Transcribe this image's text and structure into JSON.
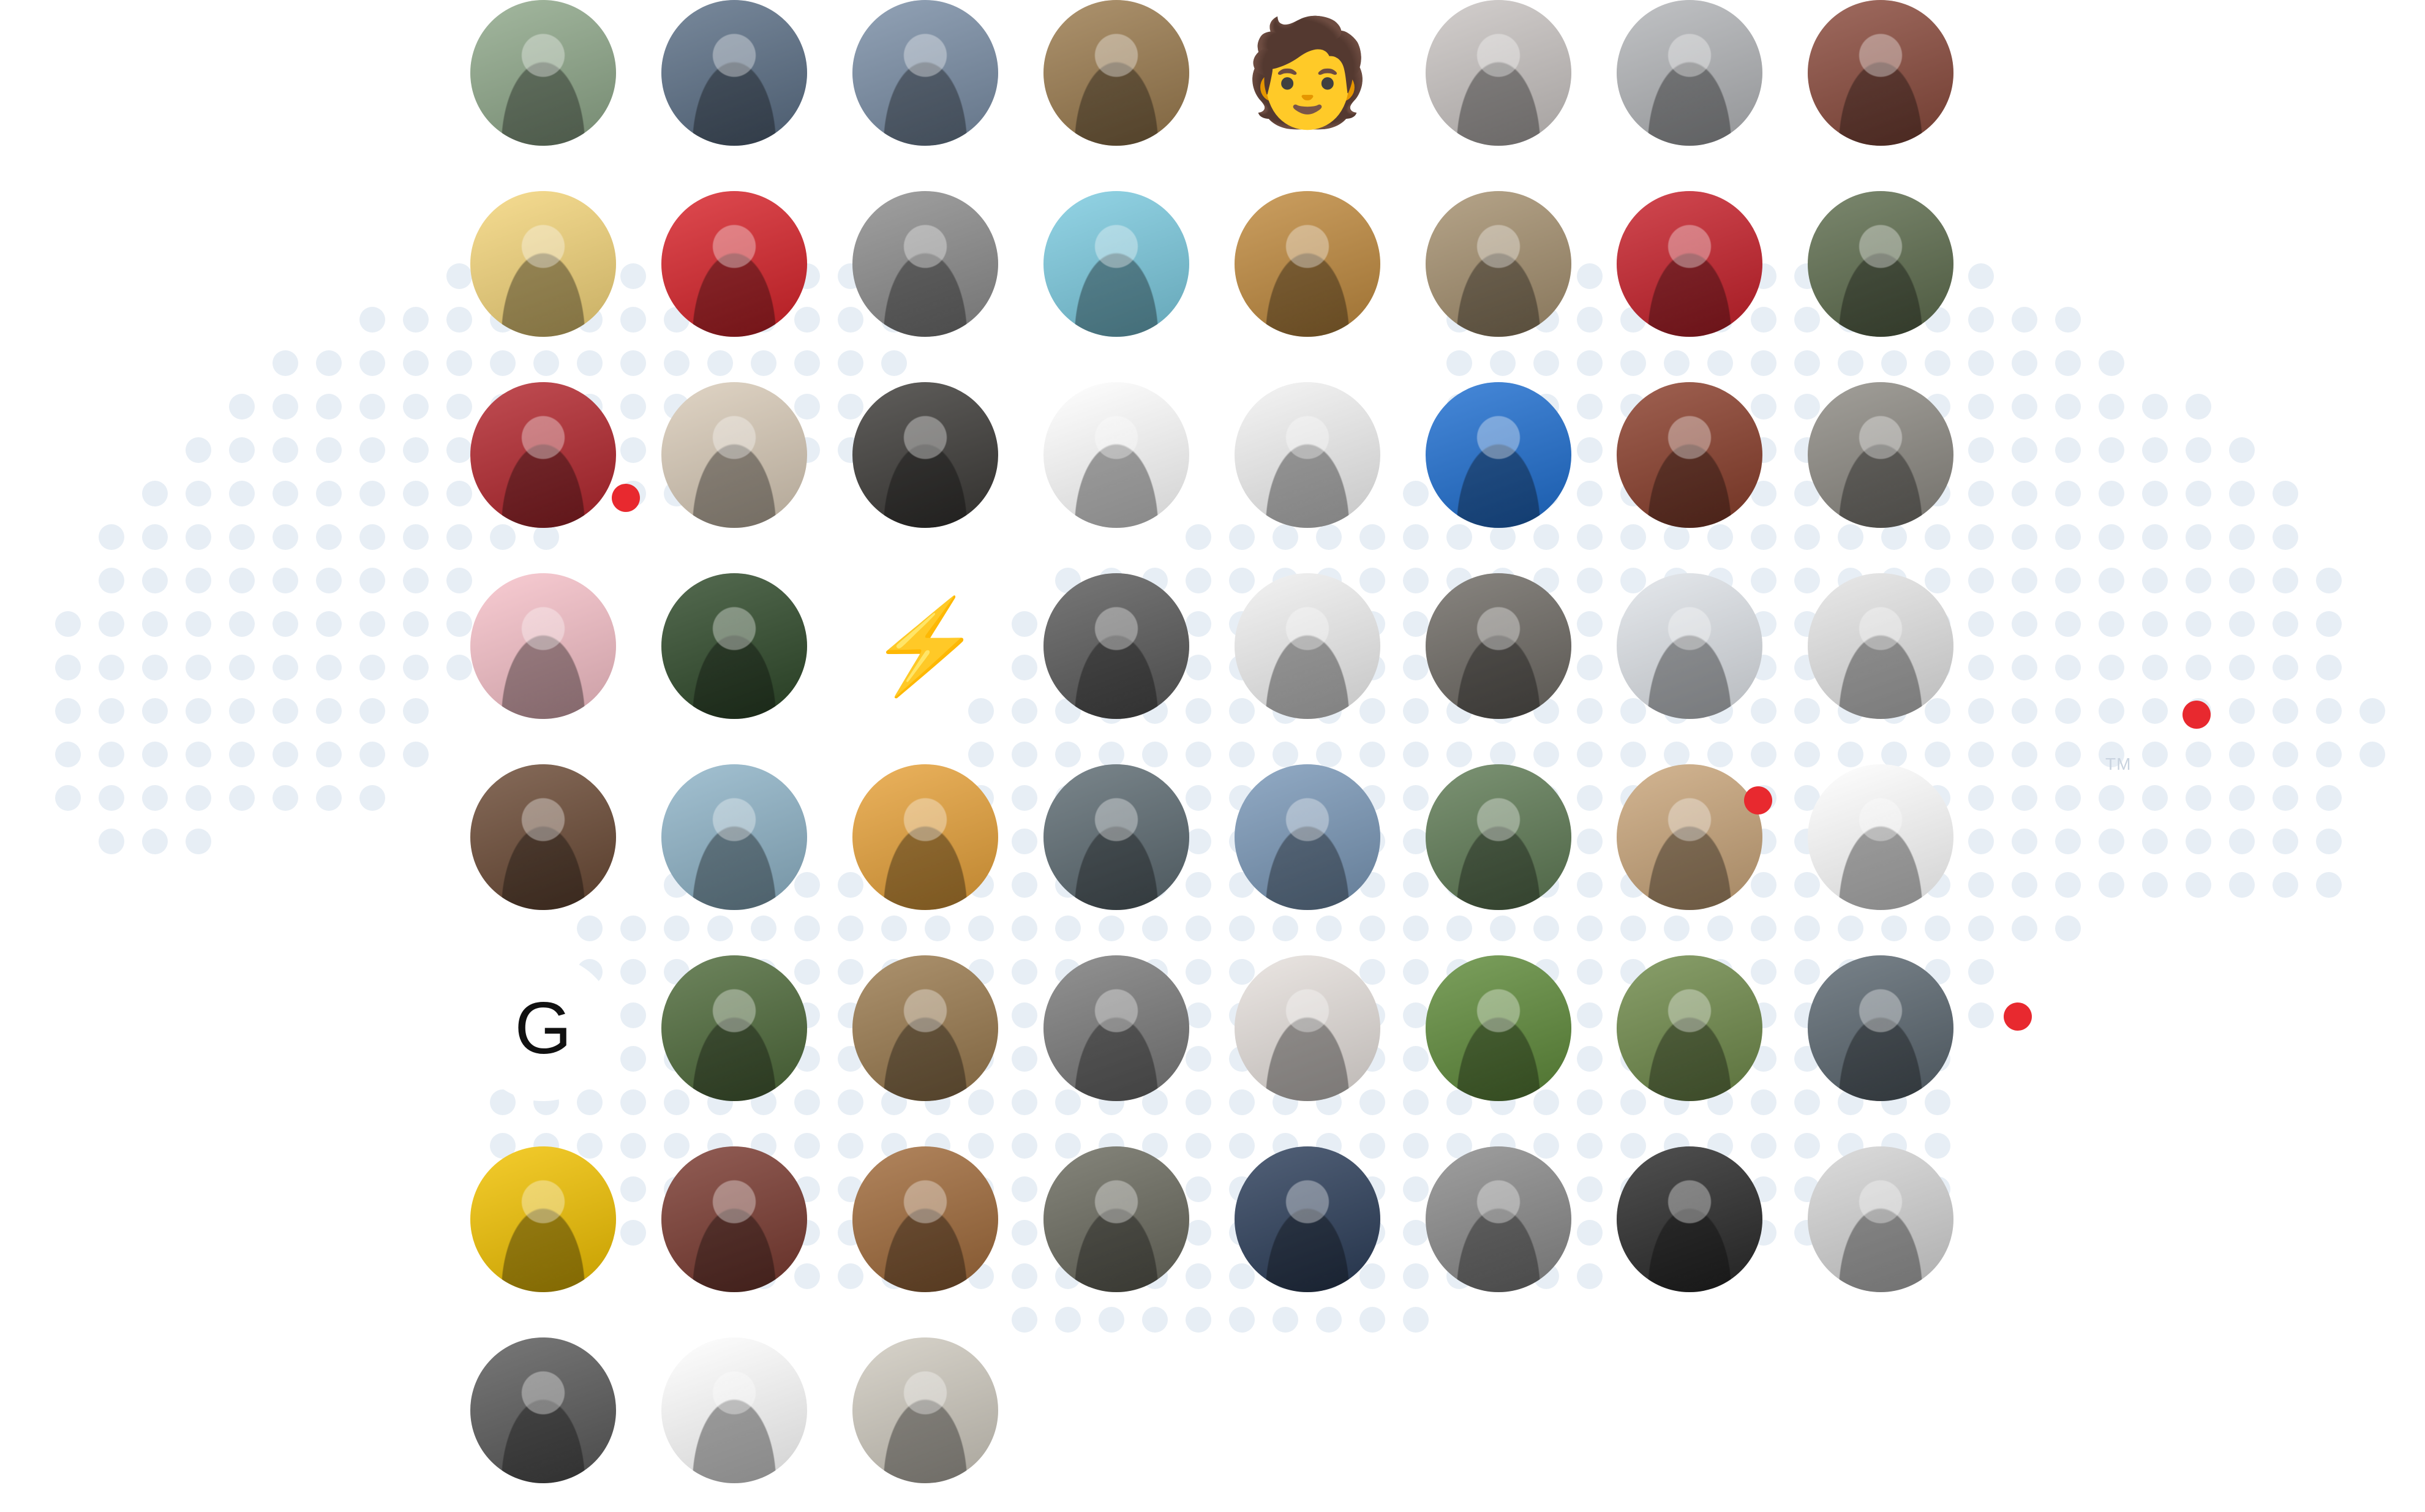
{
  "colors": {
    "map_dot": "#e7eef5",
    "marker": "#e8292f",
    "avatar_bg_default": "#8a8f96"
  },
  "world_map": {
    "trademark": "TM"
  },
  "avatars": [
    {
      "name": "avatar-1-1",
      "bg": "#8fa88a",
      "style": "photo"
    },
    {
      "name": "avatar-1-2",
      "bg": "#5b6f86",
      "style": "photo"
    },
    {
      "name": "avatar-1-3",
      "bg": "#7a8ea6",
      "style": "photo"
    },
    {
      "name": "avatar-1-4",
      "bg": "#9b7b4e",
      "style": "photo"
    },
    {
      "name": "avatar-1-5",
      "bg": "#ffffff",
      "style": "emoji",
      "glyph": "🧑"
    },
    {
      "name": "avatar-1-6",
      "bg": "#c9c4c2",
      "style": "photo"
    },
    {
      "name": "avatar-1-7",
      "bg": "#b3b5b8",
      "style": "photo"
    },
    {
      "name": "avatar-1-8",
      "bg": "#8a4a3c",
      "style": "photo"
    },
    {
      "name": "avatar-2-1",
      "bg": "#f4d57a",
      "style": "cartoon"
    },
    {
      "name": "avatar-2-2",
      "bg": "#d8232a",
      "style": "photo"
    },
    {
      "name": "avatar-2-3",
      "bg": "#8c8c8c",
      "style": "photo"
    },
    {
      "name": "avatar-2-4",
      "bg": "#7ccbe0",
      "style": "cartoon"
    },
    {
      "name": "avatar-2-5",
      "bg": "#c08a3e",
      "style": "photo"
    },
    {
      "name": "avatar-2-6",
      "bg": "#a5906f",
      "style": "photo"
    },
    {
      "name": "avatar-2-7",
      "bg": "#c7202a",
      "style": "photo"
    },
    {
      "name": "avatar-2-8",
      "bg": "#5e6d4e",
      "style": "photo"
    },
    {
      "name": "avatar-3-1",
      "bg": "#b3262d",
      "style": "photo"
    },
    {
      "name": "avatar-3-2",
      "bg": "#d9cbb8",
      "style": "photo"
    },
    {
      "name": "avatar-3-3",
      "bg": "#3d3b38",
      "style": "photo"
    },
    {
      "name": "avatar-3-4",
      "bg": "#ffffff",
      "style": "cartoon"
    },
    {
      "name": "avatar-3-5",
      "bg": "#f2f2f2",
      "style": "photo"
    },
    {
      "name": "avatar-3-6",
      "bg": "#1f6fd1",
      "style": "photo"
    },
    {
      "name": "avatar-3-7",
      "bg": "#8a3e2b",
      "style": "photo"
    },
    {
      "name": "avatar-3-8",
      "bg": "#8d8a83",
      "style": "photo"
    },
    {
      "name": "avatar-4-1",
      "bg": "#f7c1c9",
      "style": "cartoon"
    },
    {
      "name": "avatar-4-2",
      "bg": "#2f4a2a",
      "style": "photo"
    },
    {
      "name": "avatar-4-3",
      "bg": "#ffffff",
      "style": "icon",
      "glyph": "⚡",
      "glyph_color": "#f5c400"
    },
    {
      "name": "avatar-4-4",
      "bg": "#5a5a5a",
      "style": "photo"
    },
    {
      "name": "avatar-4-5",
      "bg": "#f0f0f0",
      "style": "photo"
    },
    {
      "name": "avatar-4-6",
      "bg": "#6e6a64",
      "style": "photo"
    },
    {
      "name": "avatar-4-7",
      "bg": "#dfe3e8",
      "style": "photo"
    },
    {
      "name": "avatar-4-8",
      "bg": "#e4e4e4",
      "style": "photo"
    },
    {
      "name": "avatar-5-1",
      "bg": "#6b4a35",
      "style": "photo"
    },
    {
      "name": "avatar-5-2",
      "bg": "#8fb4c8",
      "style": "photo"
    },
    {
      "name": "avatar-5-3",
      "bg": "#e7a23a",
      "style": "cartoon"
    },
    {
      "name": "avatar-5-4",
      "bg": "#5d6b72",
      "style": "photo"
    },
    {
      "name": "avatar-5-5",
      "bg": "#7a98b8",
      "style": "photo"
    },
    {
      "name": "avatar-5-6",
      "bg": "#5f7b55",
      "style": "photo"
    },
    {
      "name": "avatar-5-7",
      "bg": "#c9a57a",
      "style": "photo"
    },
    {
      "name": "avatar-5-8",
      "bg": "#ffffff",
      "style": "cartoon"
    },
    {
      "name": "avatar-6-1",
      "bg": "#ffffff",
      "style": "letter",
      "glyph": "G",
      "glyph_color": "#111111"
    },
    {
      "name": "avatar-6-2",
      "bg": "#4e6a3a",
      "style": "photo"
    },
    {
      "name": "avatar-6-3",
      "bg": "#9a7a4e",
      "style": "photo"
    },
    {
      "name": "avatar-6-4",
      "bg": "#7a7a7a",
      "style": "photo"
    },
    {
      "name": "avatar-6-5",
      "bg": "#e6e0dc",
      "style": "photo"
    },
    {
      "name": "avatar-6-6",
      "bg": "#5f8b3a",
      "style": "photo"
    },
    {
      "name": "avatar-6-7",
      "bg": "#6f8a4a",
      "style": "photo"
    },
    {
      "name": "avatar-6-8",
      "bg": "#5b6770",
      "style": "photo"
    },
    {
      "name": "avatar-7-1",
      "bg": "#f2c200",
      "style": "photo"
    },
    {
      "name": "avatar-7-2",
      "bg": "#7a3a30",
      "style": "photo"
    },
    {
      "name": "avatar-7-3",
      "bg": "#a06a3a",
      "style": "photo"
    },
    {
      "name": "avatar-7-4",
      "bg": "#6a6a5e",
      "style": "photo"
    },
    {
      "name": "avatar-7-5",
      "bg": "#2c3e5a",
      "style": "cartoon"
    },
    {
      "name": "avatar-7-6",
      "bg": "#8a8a8a",
      "style": "photo"
    },
    {
      "name": "avatar-7-7",
      "bg": "#2a2a2a",
      "style": "photo"
    },
    {
      "name": "avatar-7-8",
      "bg": "#d4d4d4",
      "style": "photo"
    },
    {
      "name": "avatar-8-1",
      "bg": "#5a5a5a",
      "style": "photo"
    },
    {
      "name": "avatar-8-2",
      "bg": "#ffffff",
      "style": "cartoon"
    },
    {
      "name": "avatar-8-3",
      "bg": "#cfcabf",
      "style": "photo"
    }
  ]
}
